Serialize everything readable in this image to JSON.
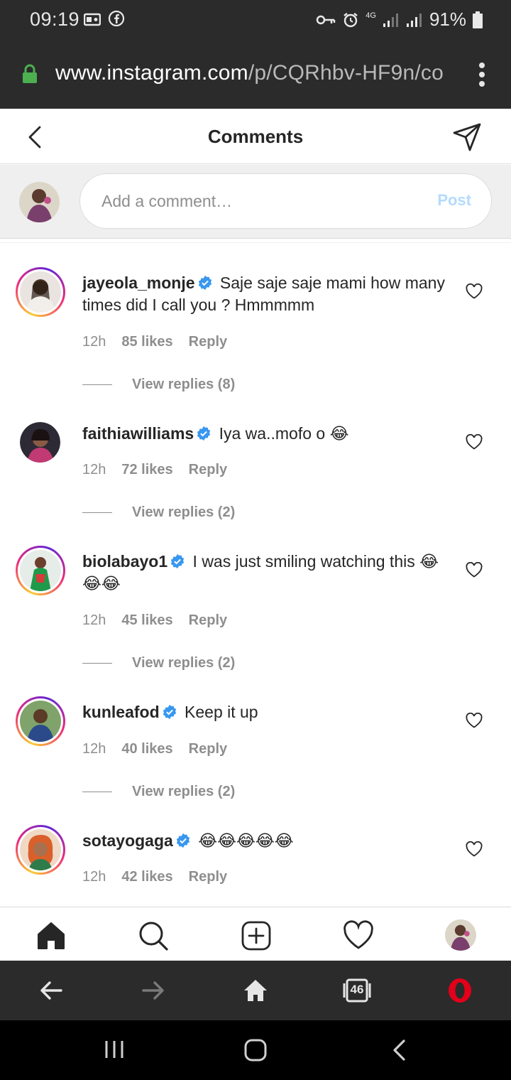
{
  "status_bar": {
    "time": "09:19",
    "battery": "91%",
    "network": "4G"
  },
  "browser": {
    "url_host": "www.instagram.com",
    "url_path": "/p/CQRhbv-HF9n/co"
  },
  "header": {
    "title": "Comments"
  },
  "add_comment": {
    "placeholder": "Add a comment…",
    "post_label": "Post"
  },
  "comments": [
    {
      "username": "jayeola_monje",
      "text": "Saje saje saje mami how many times did I call you ? Hmmmmm",
      "time": "12h",
      "likes": "85 likes",
      "reply": "Reply",
      "view_replies": "View replies (8)"
    },
    {
      "username": "faithiawilliams",
      "text": "Iya wa..mofo o 😂",
      "time": "12h",
      "likes": "72 likes",
      "reply": "Reply",
      "view_replies": "View replies (2)"
    },
    {
      "username": "biolabayo1",
      "text": "I was just smiling watching this 😂😂😂",
      "time": "12h",
      "likes": "45 likes",
      "reply": "Reply",
      "view_replies": "View replies (2)"
    },
    {
      "username": "kunleafod",
      "text": "Keep it up",
      "time": "12h",
      "likes": "40 likes",
      "reply": "Reply",
      "view_replies": "View replies (2)"
    },
    {
      "username": "sotayogaga",
      "text": "😂😂😂😂😂",
      "time": "12h",
      "likes": "42 likes",
      "reply": "Reply"
    }
  ],
  "opera": {
    "tab_count": "46"
  },
  "icons": {
    "verified": "verified-badge-icon",
    "heart": "heart-icon",
    "home": "home-icon",
    "search": "search-icon",
    "new_post": "new-post-icon",
    "activity": "activity-heart-icon"
  },
  "colors": {
    "verified_blue": "#3897f0",
    "post_disabled": "#b3dbff",
    "opera_red": "#e2001a"
  }
}
